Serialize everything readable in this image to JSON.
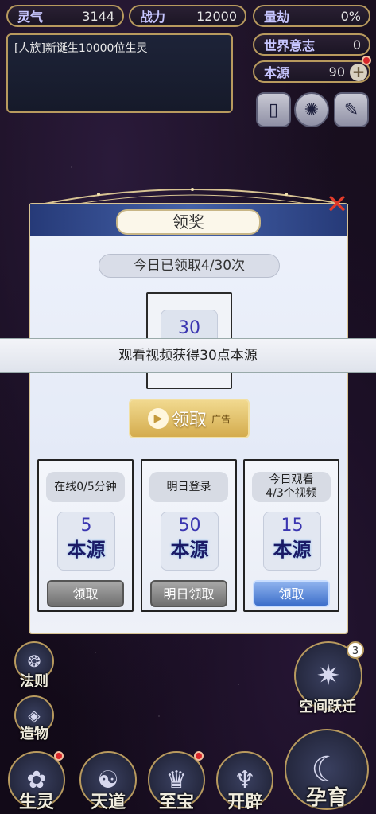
{
  "stats": {
    "lingqi": {
      "label": "灵气",
      "value": "3144"
    },
    "zhanli": {
      "label": "战力",
      "value": "12000"
    },
    "liangjie": {
      "label": "量劫",
      "value": "0%"
    },
    "shijie": {
      "label": "世界意志",
      "value": "0"
    },
    "benyuan": {
      "label": "本源",
      "value": "90"
    }
  },
  "message": "[人族]新诞生10000位生灵",
  "modal": {
    "title": "领奖",
    "close": "✕",
    "daily_count": "今日已领取4/30次",
    "reward_value": "30",
    "banner_text": "观看视频获得30点本源",
    "claim_label": "领取",
    "ad_label": "广告",
    "cards": [
      {
        "label": "在线0/5分钟",
        "amount": "5",
        "unit": "本源",
        "button": "领取"
      },
      {
        "label": "明日登录",
        "amount": "50",
        "unit": "本源",
        "button": "明日领取"
      },
      {
        "label": "今日观看\n4/3个视频",
        "amount": "15",
        "unit": "本源",
        "button": "领取"
      }
    ]
  },
  "side": {
    "faze": "法则",
    "zaowu": "造物",
    "kongjian": "空间跃迁",
    "kongjian_badge": "3"
  },
  "bottom_nav": {
    "shengling": "生灵",
    "tiandao": "天道",
    "zhibao": "至宝",
    "kaipi": "开辟",
    "yunyu": "孕育"
  },
  "colors": {
    "accent_gold": "#b89a5e",
    "stat_label": "#c7c6ff",
    "reward_blue": "#3a35b0"
  }
}
